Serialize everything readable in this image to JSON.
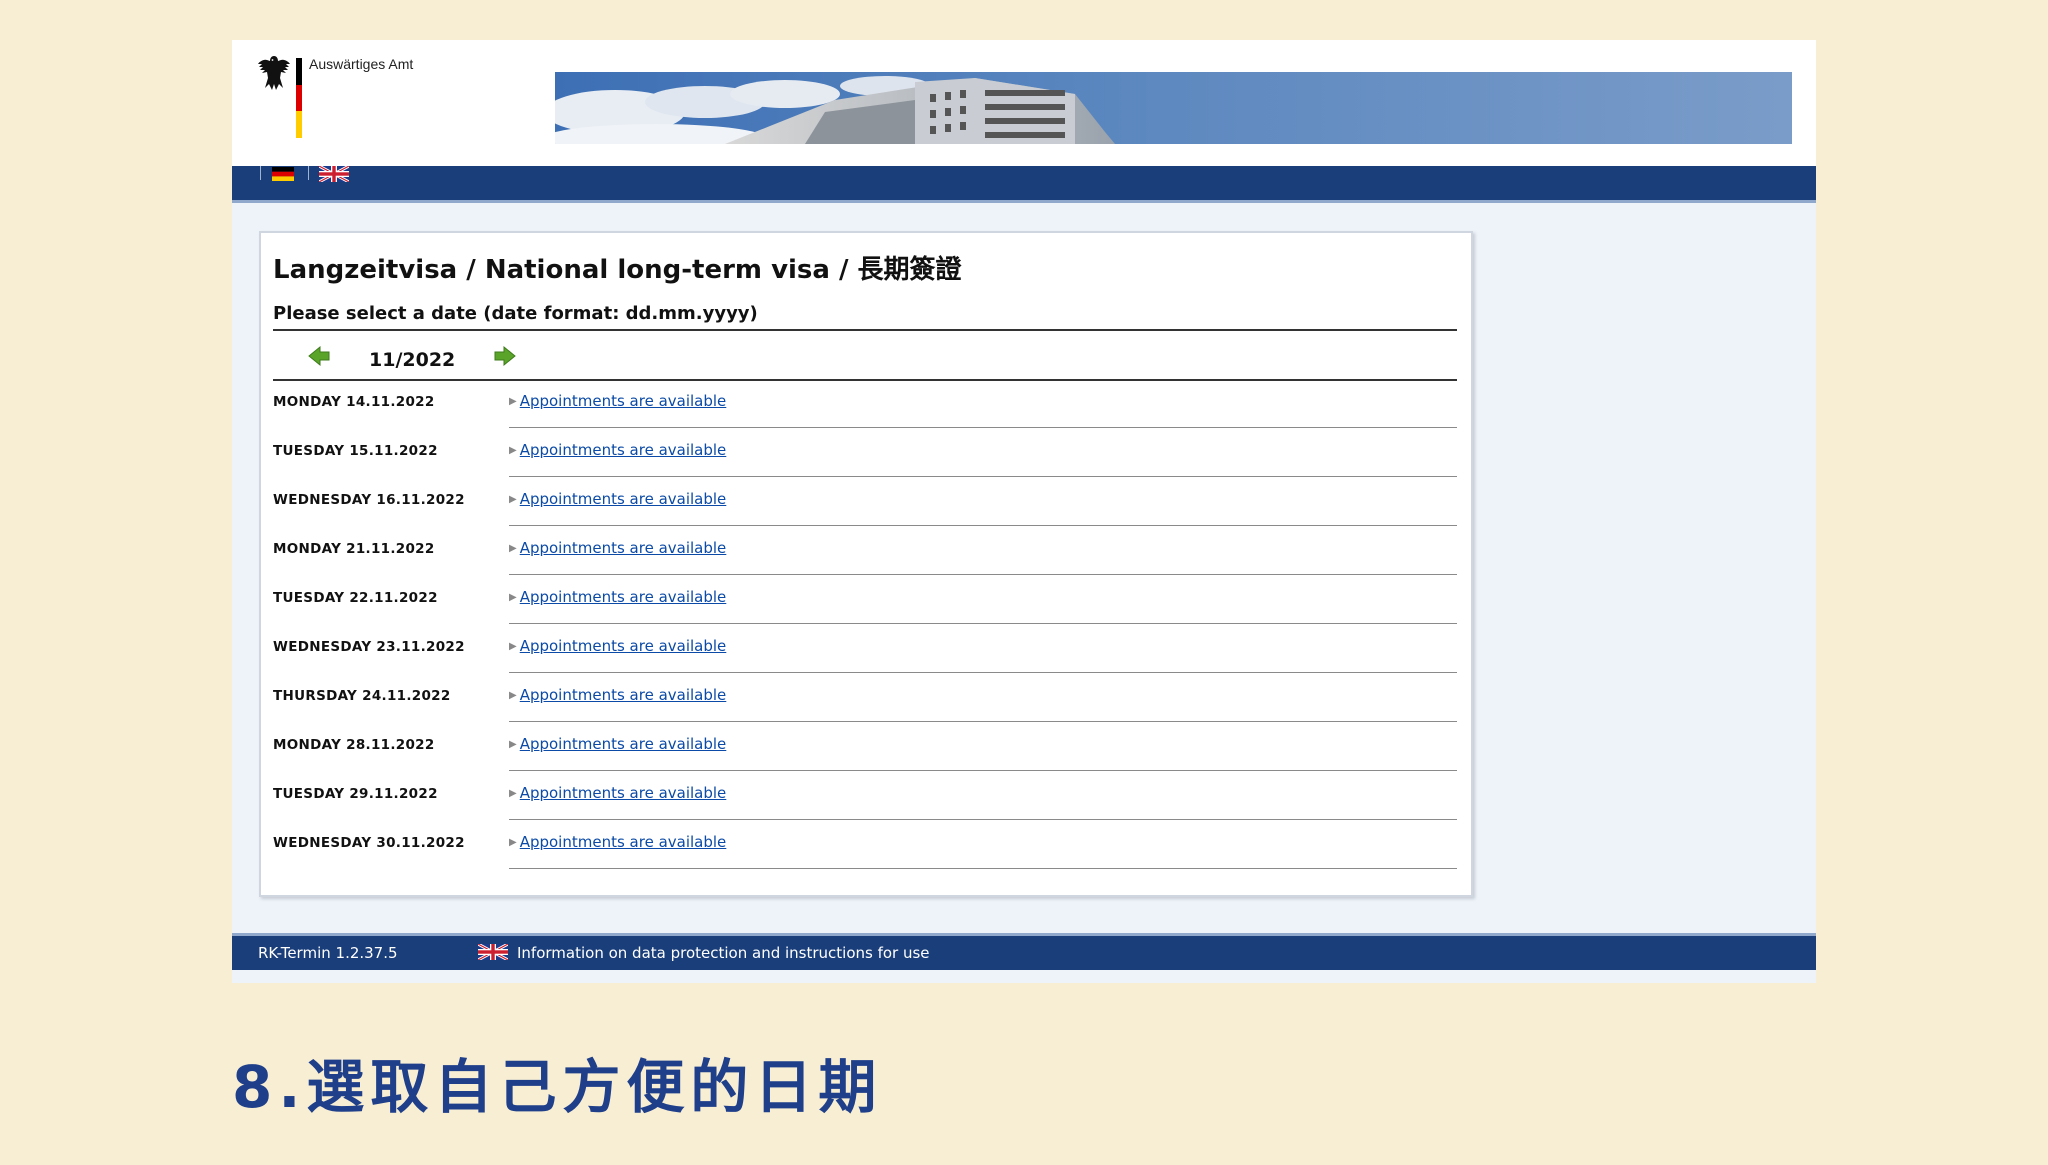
{
  "header": {
    "org_name": "Auswärtiges Amt"
  },
  "nav": {
    "languages": [
      "german-flag",
      "uk-flag"
    ]
  },
  "page": {
    "title": "Langzeitvisa / National long-term visa / 長期簽證",
    "prompt": "Please select a date (date format: dd.mm.yyyy)",
    "month": "11/2022"
  },
  "appointments": [
    {
      "date": "MONDAY 14.11.2022",
      "link": "Appointments are available"
    },
    {
      "date": "TUESDAY 15.11.2022",
      "link": "Appointments are available"
    },
    {
      "date": "WEDNESDAY 16.11.2022",
      "link": "Appointments are available"
    },
    {
      "date": "MONDAY 21.11.2022",
      "link": "Appointments are available"
    },
    {
      "date": "TUESDAY 22.11.2022",
      "link": "Appointments are available"
    },
    {
      "date": "WEDNESDAY 23.11.2022",
      "link": "Appointments are available"
    },
    {
      "date": "THURSDAY 24.11.2022",
      "link": "Appointments are available"
    },
    {
      "date": "MONDAY 28.11.2022",
      "link": "Appointments are available"
    },
    {
      "date": "TUESDAY 29.11.2022",
      "link": "Appointments are available"
    },
    {
      "date": "WEDNESDAY 30.11.2022",
      "link": "Appointments are available"
    }
  ],
  "footer": {
    "version": "RK-Termin 1.2.37.5",
    "info_link": "Information on data protection and instructions for use"
  },
  "caption": "8.選取自己方便的日期",
  "colors": {
    "page_bg": "#f8eed3",
    "nav_blue": "#1a3e7a",
    "link_blue": "#0b4aa6",
    "caption_blue": "#1f3f8a",
    "arrow_green": "#5aa42a"
  }
}
